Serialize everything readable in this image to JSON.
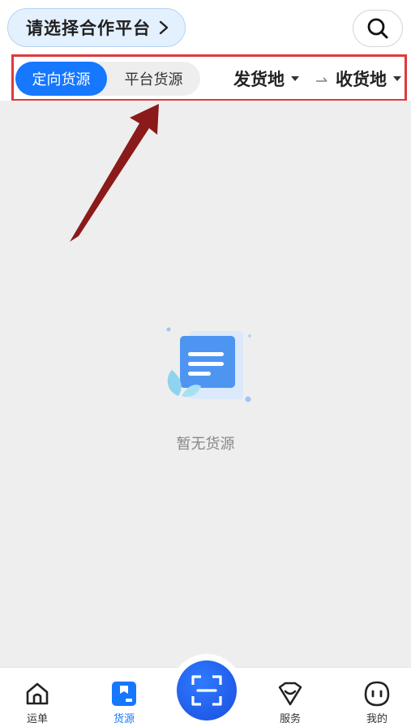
{
  "header": {
    "platform_label": "请选择合作平台"
  },
  "filters": {
    "tab_active": "定向货源",
    "tab_inactive": "平台货源",
    "origin": "发货地",
    "destination": "收货地"
  },
  "empty_state": {
    "text": "暂无货源"
  },
  "tabbar": {
    "items": [
      {
        "label": "运单",
        "icon": "home-icon"
      },
      {
        "label": "货源",
        "icon": "cargo-icon"
      },
      {
        "label": "服务",
        "icon": "service-bag-icon"
      },
      {
        "label": "我的",
        "icon": "face-icon"
      }
    ],
    "active": "货源",
    "center_icon": "scan-icon"
  },
  "colors": {
    "accent": "#1677ff",
    "highlight_box": "#e0393c",
    "annotation_arrow": "#8b1a1a",
    "content_bg": "#eeeeee"
  }
}
